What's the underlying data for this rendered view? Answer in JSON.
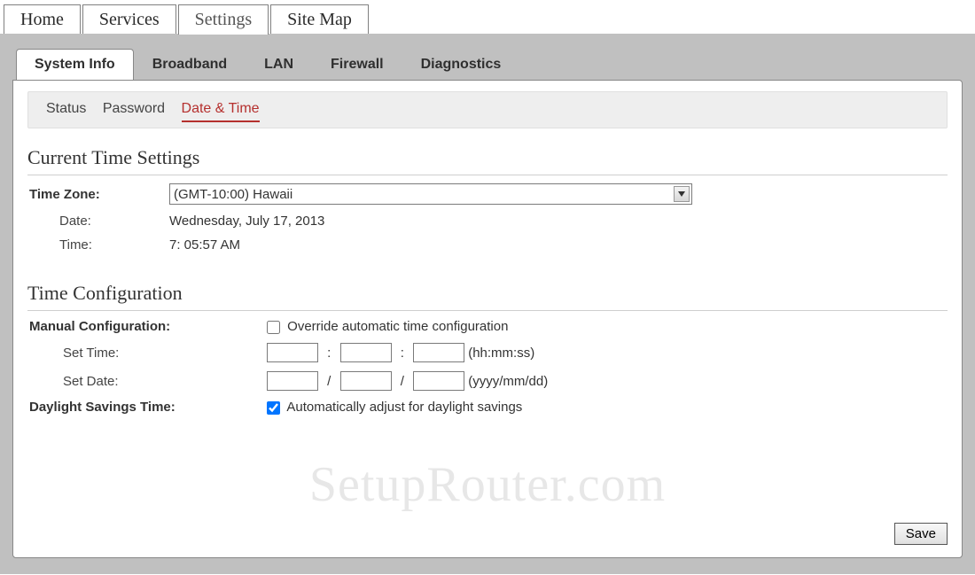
{
  "topnav": {
    "items": [
      {
        "label": "Home"
      },
      {
        "label": "Services"
      },
      {
        "label": "Settings",
        "active": true
      },
      {
        "label": "Site Map"
      }
    ]
  },
  "subtabs": {
    "items": [
      {
        "label": "System Info",
        "active": true
      },
      {
        "label": "Broadband"
      },
      {
        "label": "LAN"
      },
      {
        "label": "Firewall"
      },
      {
        "label": "Diagnostics"
      }
    ]
  },
  "tertiary": {
    "items": [
      {
        "label": "Status"
      },
      {
        "label": "Password"
      },
      {
        "label": "Date & Time",
        "active": true
      }
    ]
  },
  "sections": {
    "current_heading": "Current Time Settings",
    "config_heading": "Time Configuration"
  },
  "labels": {
    "time_zone": "Time Zone:",
    "date": "Date:",
    "time": "Time:",
    "manual_config": "Manual Configuration:",
    "set_time": "Set Time:",
    "set_date": "Set Date:",
    "dst": "Daylight Savings Time:"
  },
  "values": {
    "time_zone_selected": "(GMT-10:00) Hawaii",
    "date": "Wednesday, July 17, 2013",
    "time": "7: 05:57 AM",
    "override_label": "Override automatic time configuration",
    "override_checked": false,
    "time_hint": "(hh:mm:ss)",
    "date_hint": "(yyyy/mm/dd)",
    "dst_label": "Automatically adjust for daylight savings",
    "dst_checked": true,
    "set_time_hh": "",
    "set_time_mm": "",
    "set_time_ss": "",
    "set_date_yyyy": "",
    "set_date_mm": "",
    "set_date_dd": ""
  },
  "buttons": {
    "save": "Save"
  },
  "watermark": "SetupRouter.com"
}
